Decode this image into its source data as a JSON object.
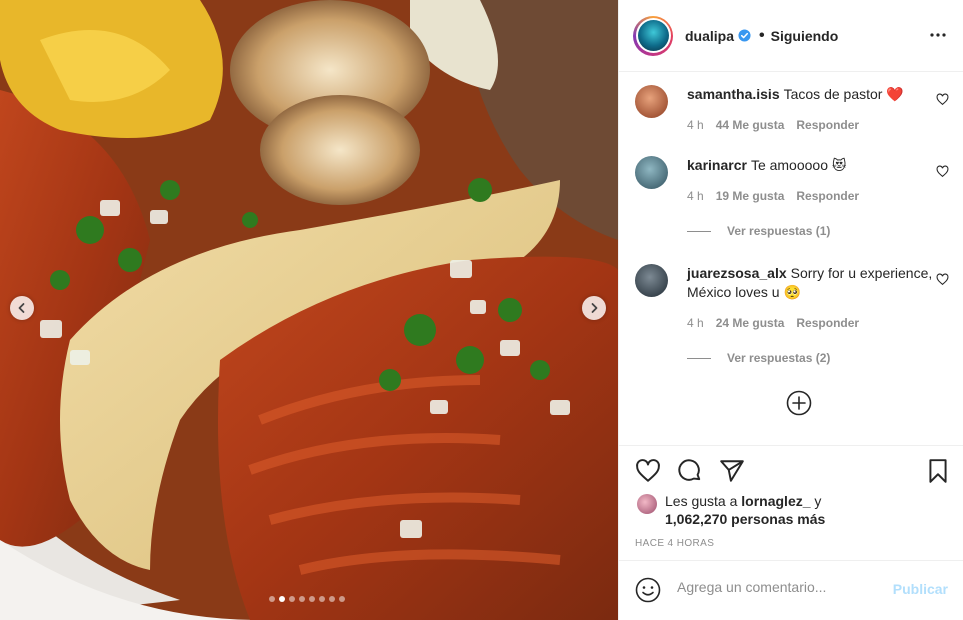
{
  "post": {
    "author": "dualipa",
    "separator": "•",
    "follow_status": "Siguiendo",
    "verified": true
  },
  "carousel": {
    "slide_count": 8,
    "active_slide": 2
  },
  "comments": [
    {
      "username": "samantha.isis",
      "text": "Tacos de pastor ❤️",
      "time": "4 h",
      "likes": "44 Me gusta",
      "reply": "Responder",
      "avatar_color": "#b0552e"
    },
    {
      "username": "karinarcr",
      "text": "Te amooooo 😻",
      "time": "4 h",
      "likes": "19 Me gusta",
      "reply": "Responder",
      "view_replies": "Ver respuestas (1)",
      "avatar_color": "#3b5f6e"
    },
    {
      "username": "juarezsosa_alx",
      "text": "Sorry for u experience, México loves u 🥺",
      "time": "4 h",
      "likes": "24 Me gusta",
      "reply": "Responder",
      "view_replies": "Ver respuestas (2)",
      "avatar_color": "#2d3a44"
    }
  ],
  "likes": {
    "prefix": "Les gusta a",
    "liker": "lornaglez_",
    "conjunction": "y",
    "count_text": "1,062,270 personas más"
  },
  "timestamp": "HACE 4 HORAS",
  "composer": {
    "placeholder": "Agrega un comentario...",
    "publish_label": "Publicar"
  },
  "icons": {
    "more": "more-dots-icon",
    "like": "heart-icon",
    "comment": "comment-icon",
    "share": "send-icon",
    "save": "bookmark-icon",
    "emoji": "emoji-icon",
    "load_more": "plus-circle-icon"
  }
}
